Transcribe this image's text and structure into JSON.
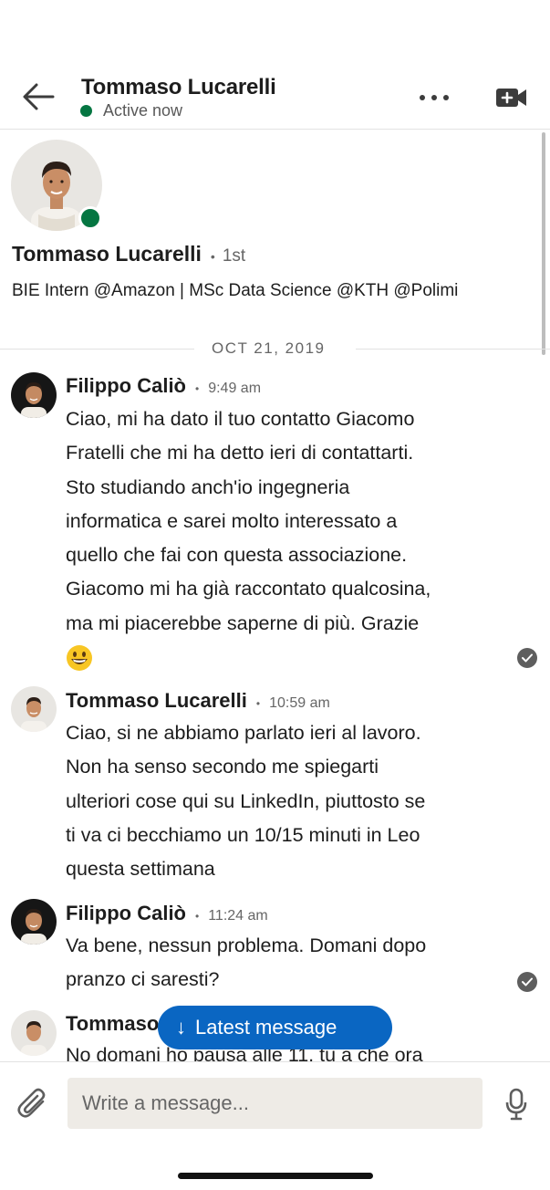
{
  "header": {
    "name": "Tommaso Lucarelli",
    "status": "Active now"
  },
  "profile": {
    "name": "Tommaso Lucarelli",
    "degree": "1st",
    "headline": "BIE Intern @Amazon | MSc Data Science @KTH @Polimi"
  },
  "date_divider": "OCT 21, 2019",
  "messages": [
    {
      "sender": "Filippo Caliò",
      "time": "9:49 am",
      "lines": [
        "Ciao, mi ha dato il tuo contatto Giacomo",
        "Fratelli che mi ha detto ieri di contattarti.",
        "Sto studiando anch'io ingegneria",
        "informatica e sarei molto interessato a",
        "quello che fai con questa associazione.",
        "Giacomo mi ha già raccontato qualcosina,",
        "ma mi piacerebbe saperne di più. Grazie"
      ],
      "emoji": "grinning-face-emoji",
      "read": true
    },
    {
      "sender": "Tommaso Lucarelli",
      "time": "10:59 am",
      "lines": [
        "Ciao, si ne abbiamo parlato ieri al lavoro.",
        "Non ha senso secondo me spiegarti",
        "ulteriori cose qui su LinkedIn, piuttosto se",
        "ti va ci becchiamo un 10/15 minuti in Leo",
        "questa settimana"
      ],
      "read": false
    },
    {
      "sender": "Filippo Caliò",
      "time": "11:24 am",
      "lines": [
        "Va bene, nessun problema. Domani dopo",
        "pranzo ci saresti?"
      ],
      "read": true
    },
    {
      "sender": "Tommaso",
      "lines": [
        "No domani ho pausa alle 11, tu a che ora"
      ]
    }
  ],
  "latest_message_button": "Latest message",
  "compose": {
    "placeholder": "Write a message..."
  },
  "colors": {
    "accent": "#0a66c2",
    "online": "#057642"
  }
}
